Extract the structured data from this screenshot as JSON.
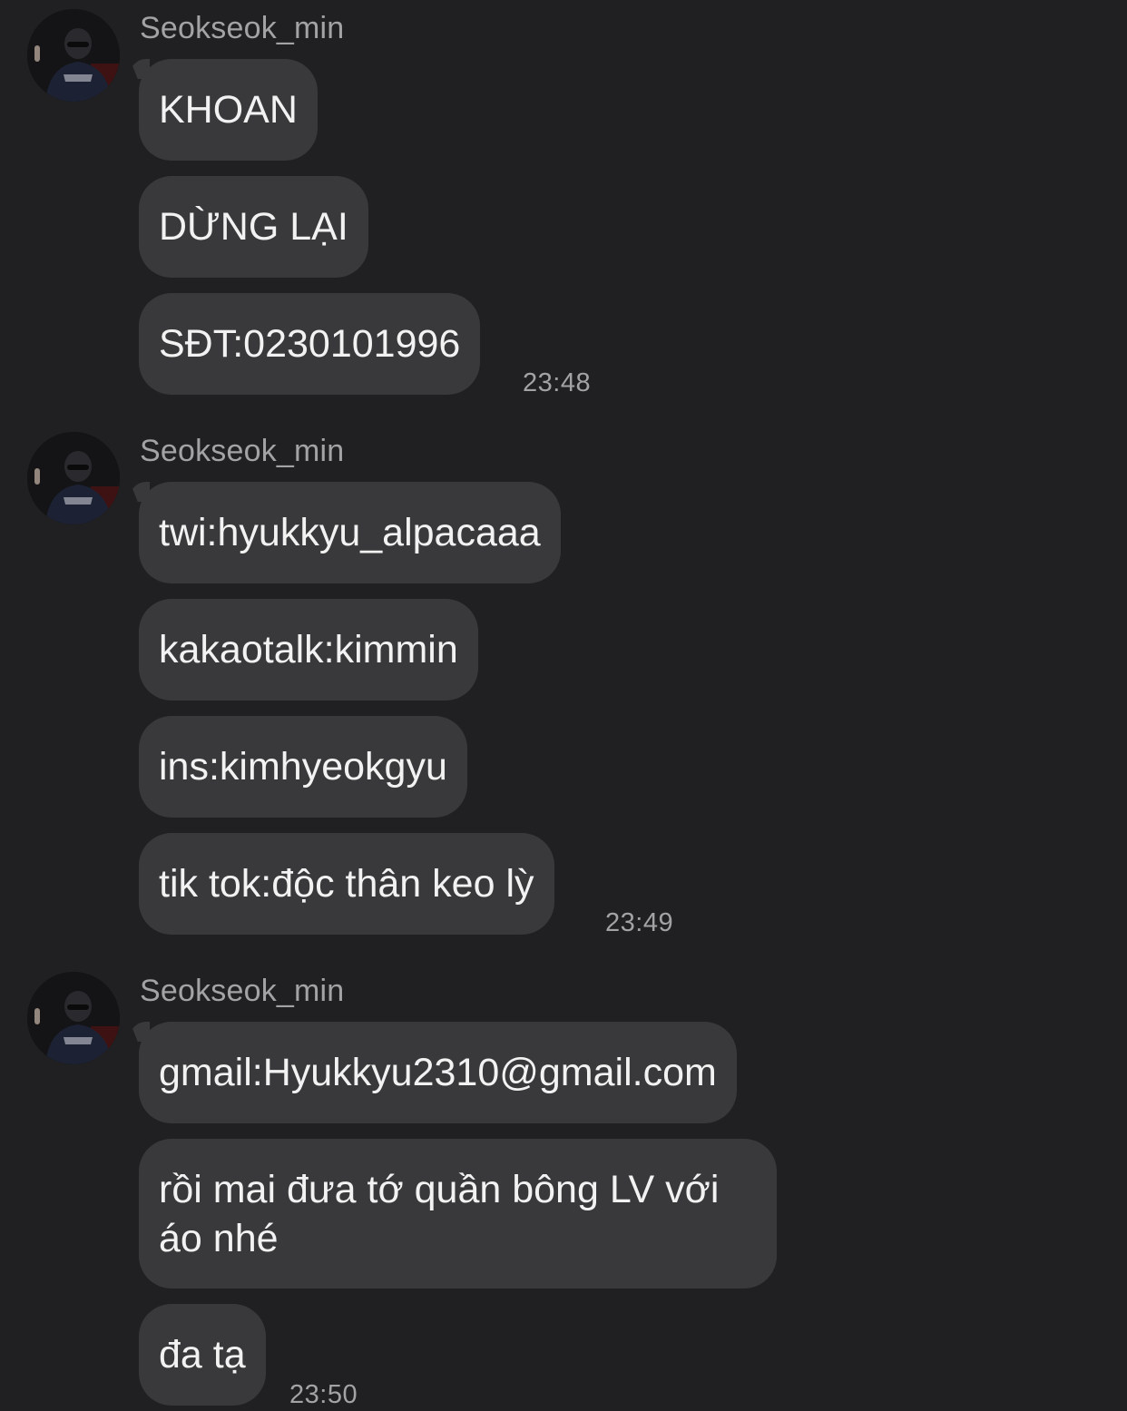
{
  "theme": {
    "background": "#202022",
    "bubble": "#39393b",
    "text": "#f2f2f2",
    "muted": "#a3a3a6"
  },
  "groups": [
    {
      "sender": "Seokseok_min",
      "avatar_icon": "user-avatar-photo",
      "messages": [
        "KHOAN",
        "DỪNG LẠI",
        "SĐT:0230101996"
      ],
      "time": "23:48"
    },
    {
      "sender": "Seokseok_min",
      "avatar_icon": "user-avatar-photo",
      "messages": [
        "twi:hyukkyu_alpacaaa",
        "kakaotalk:kimmin",
        "ins:kimhyeokgyu",
        "tik tok:độc thân keo lỳ"
      ],
      "time": "23:49"
    },
    {
      "sender": "Seokseok_min",
      "avatar_icon": "user-avatar-photo",
      "messages": [
        "gmail:Hyukkyu2310@gmail.com",
        "rồi mai đưa tớ quần bông LV với áo nhé",
        "đa tạ"
      ],
      "time": "23:50"
    }
  ]
}
